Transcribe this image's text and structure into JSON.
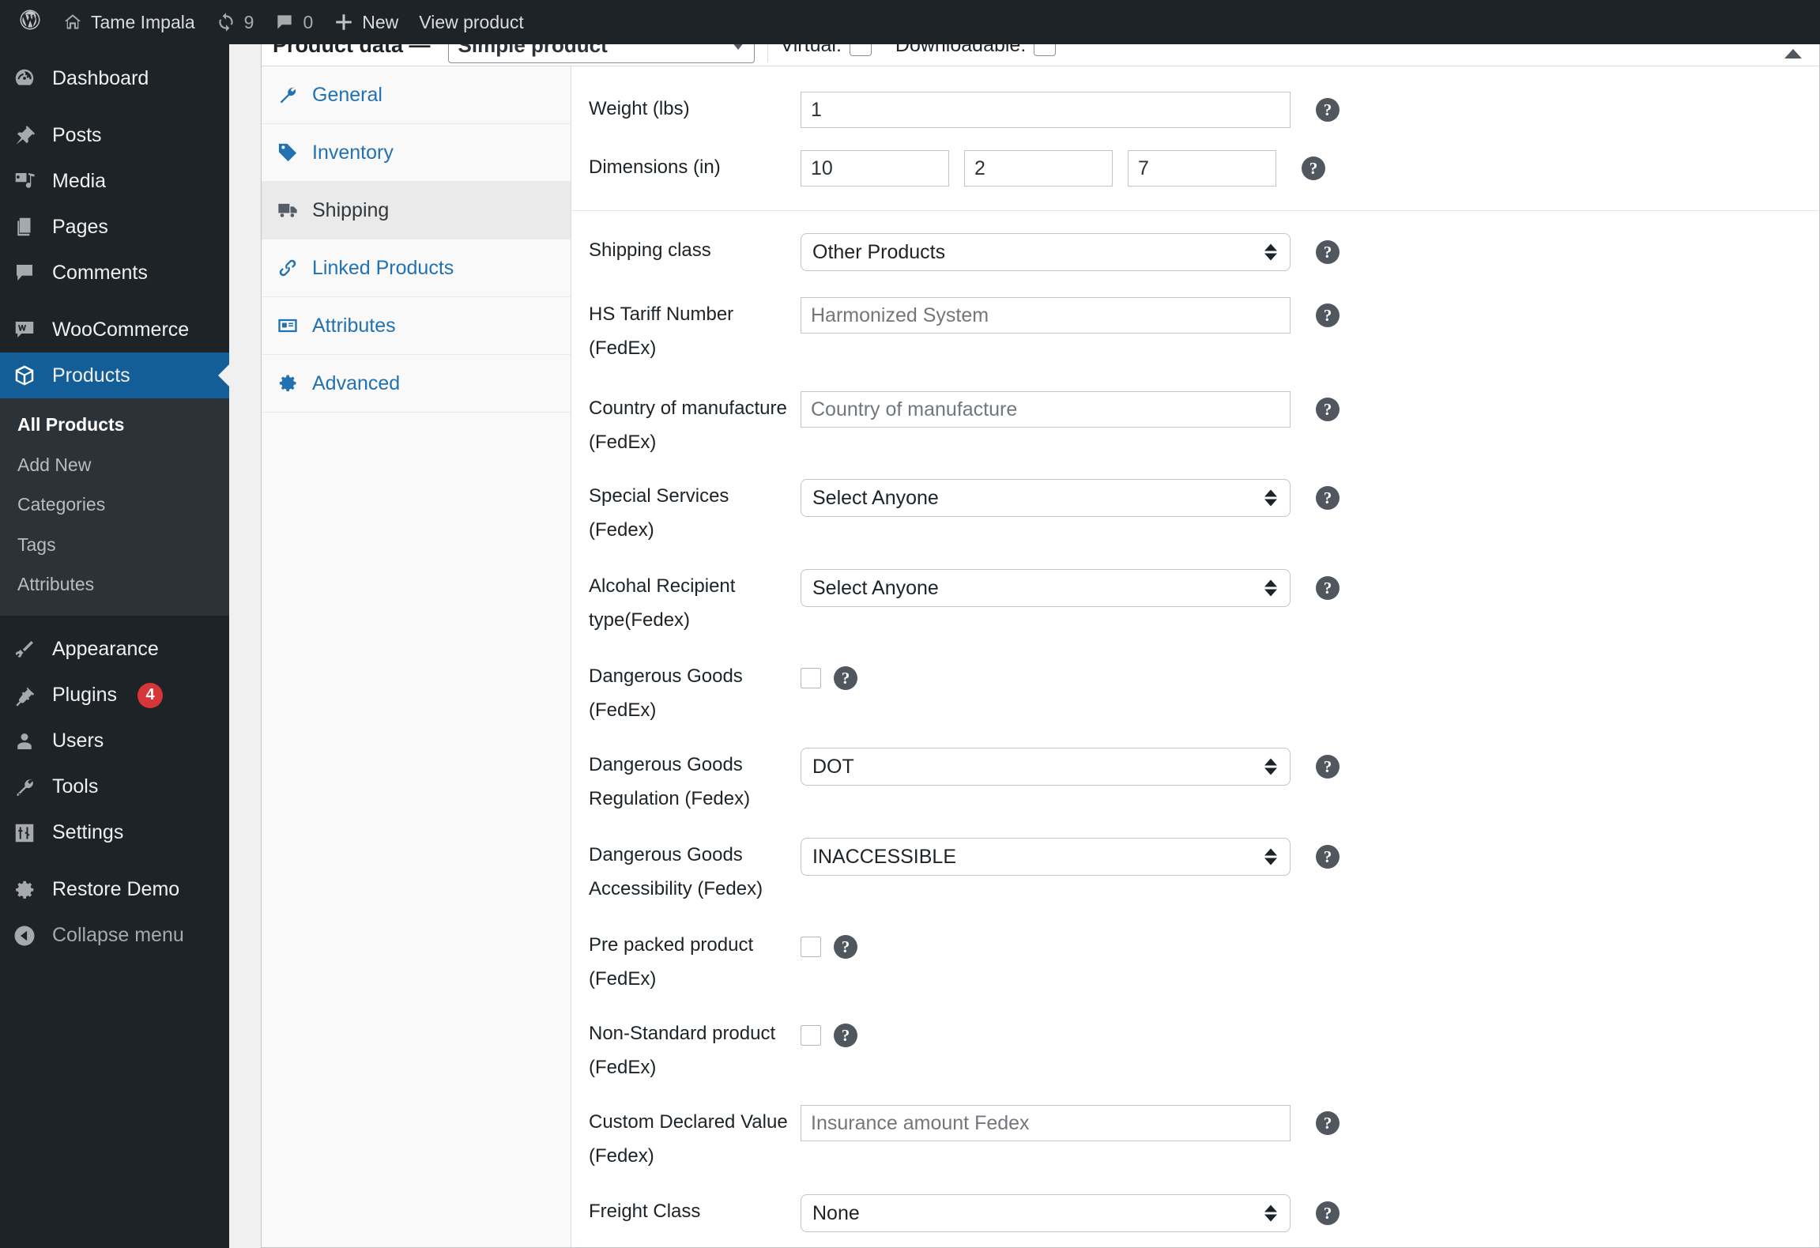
{
  "adminbar": {
    "logo_icon": "wordpress-logo-icon",
    "site_icon": "home-icon",
    "site_name": "Tame Impala",
    "updates_icon": "updates-icon",
    "updates_count": "9",
    "comments_icon": "comment-bubble-icon",
    "comments_count": "0",
    "new_icon": "plus-icon",
    "new_label": "New",
    "view_product_label": "View product"
  },
  "sidebar": {
    "items": [
      {
        "label": "Dashboard",
        "icon": "dashboard-icon",
        "current": false
      },
      {
        "label": "Posts",
        "icon": "pin-icon",
        "current": false
      },
      {
        "label": "Media",
        "icon": "media-icon",
        "current": false
      },
      {
        "label": "Pages",
        "icon": "pages-icon",
        "current": false
      },
      {
        "label": "Comments",
        "icon": "comment-bubble-icon",
        "current": false
      },
      {
        "label": "WooCommerce",
        "icon": "woocommerce-icon",
        "current": false
      },
      {
        "label": "Products",
        "icon": "products-box-icon",
        "current": true
      },
      {
        "label": "Appearance",
        "icon": "paintbrush-icon",
        "current": false
      },
      {
        "label": "Plugins",
        "icon": "plug-icon",
        "badge": "4",
        "current": false
      },
      {
        "label": "Users",
        "icon": "user-icon",
        "current": false
      },
      {
        "label": "Tools",
        "icon": "wrench-icon",
        "current": false
      },
      {
        "label": "Settings",
        "icon": "settings-sliders-icon",
        "current": false
      },
      {
        "label": "Restore Demo",
        "icon": "gear-icon",
        "current": false
      },
      {
        "label": "Collapse menu",
        "icon": "collapse-arrow-icon",
        "current": false
      }
    ],
    "submenu": [
      {
        "label": "All Products",
        "current": true
      },
      {
        "label": "Add New",
        "current": false
      },
      {
        "label": "Categories",
        "current": false
      },
      {
        "label": "Tags",
        "current": false
      },
      {
        "label": "Attributes",
        "current": false
      }
    ],
    "active_color": "#135e96",
    "badge_color": "#d63638"
  },
  "product_data": {
    "title": "Product data —",
    "type_value": "Simple product",
    "virtual_label": "Virtual:",
    "virtual_checked": false,
    "downloadable_label": "Downloadable:",
    "downloadable_checked": false,
    "collapse_icon": "chevron-up-icon"
  },
  "tabs": [
    {
      "label": "General",
      "icon": "wrench-icon",
      "active": false
    },
    {
      "label": "Inventory",
      "icon": "tag-icon",
      "active": false
    },
    {
      "label": "Shipping",
      "icon": "truck-icon",
      "active": true
    },
    {
      "label": "Linked Products",
      "icon": "link-icon",
      "active": false
    },
    {
      "label": "Attributes",
      "icon": "id-card-icon",
      "active": false
    },
    {
      "label": "Advanced",
      "icon": "gear-icon",
      "active": false
    }
  ],
  "shipping_panel": {
    "weight": {
      "label": "Weight (lbs)",
      "value": "1",
      "help_icon": "help-icon"
    },
    "dimensions": {
      "label": "Dimensions (in)",
      "length": "10",
      "width": "2",
      "height": "7",
      "help_icon": "help-icon"
    },
    "shipping_class": {
      "label": "Shipping class",
      "value": "Other Products",
      "help_icon": "help-icon"
    },
    "hs_tariff": {
      "label": "HS Tariff Number (FedEx)",
      "placeholder": "Harmonized System",
      "value": "",
      "help_icon": "help-icon"
    },
    "country_of_manufacture": {
      "label_line1": "Country of manufacture",
      "label_line2": "(FedEx)",
      "placeholder": "Country of manufacture",
      "value": "",
      "help_icon": "help-icon"
    },
    "special_services": {
      "label": "Special Services (Fedex)",
      "value": "Select Anyone",
      "help_icon": "help-icon"
    },
    "alcohol_recipient": {
      "label_line1": "Alcohal Recipient",
      "label_line2": "type(Fedex)",
      "value": "Select Anyone",
      "help_icon": "help-icon"
    },
    "dangerous_goods": {
      "label_line1": "Dangerous Goods",
      "label_line2": "(FedEx)",
      "checked": false,
      "help_icon": "help-icon"
    },
    "dangerous_goods_regulation": {
      "label_line1": "Dangerous Goods",
      "label_line2": "Regulation (Fedex)",
      "value": "DOT",
      "help_icon": "help-icon"
    },
    "dangerous_goods_accessibility": {
      "label_line1": "Dangerous Goods",
      "label_line2": "Accessibility (Fedex)",
      "value": "INACCESSIBLE",
      "help_icon": "help-icon"
    },
    "pre_packed": {
      "label_line1": "Pre packed product",
      "label_line2": "(FedEx)",
      "checked": false,
      "help_icon": "help-icon"
    },
    "non_standard": {
      "label_line1": "Non-Standard product",
      "label_line2": "(FedEx)",
      "checked": false,
      "help_icon": "help-icon"
    },
    "custom_declared_value": {
      "label_line1": "Custom Declared Value",
      "label_line2": "(Fedex)",
      "placeholder": "Insurance amount Fedex",
      "value": "",
      "help_icon": "help-icon"
    },
    "freight_class": {
      "label": "Freight Class",
      "value": "None",
      "help_icon": "help-icon"
    }
  }
}
